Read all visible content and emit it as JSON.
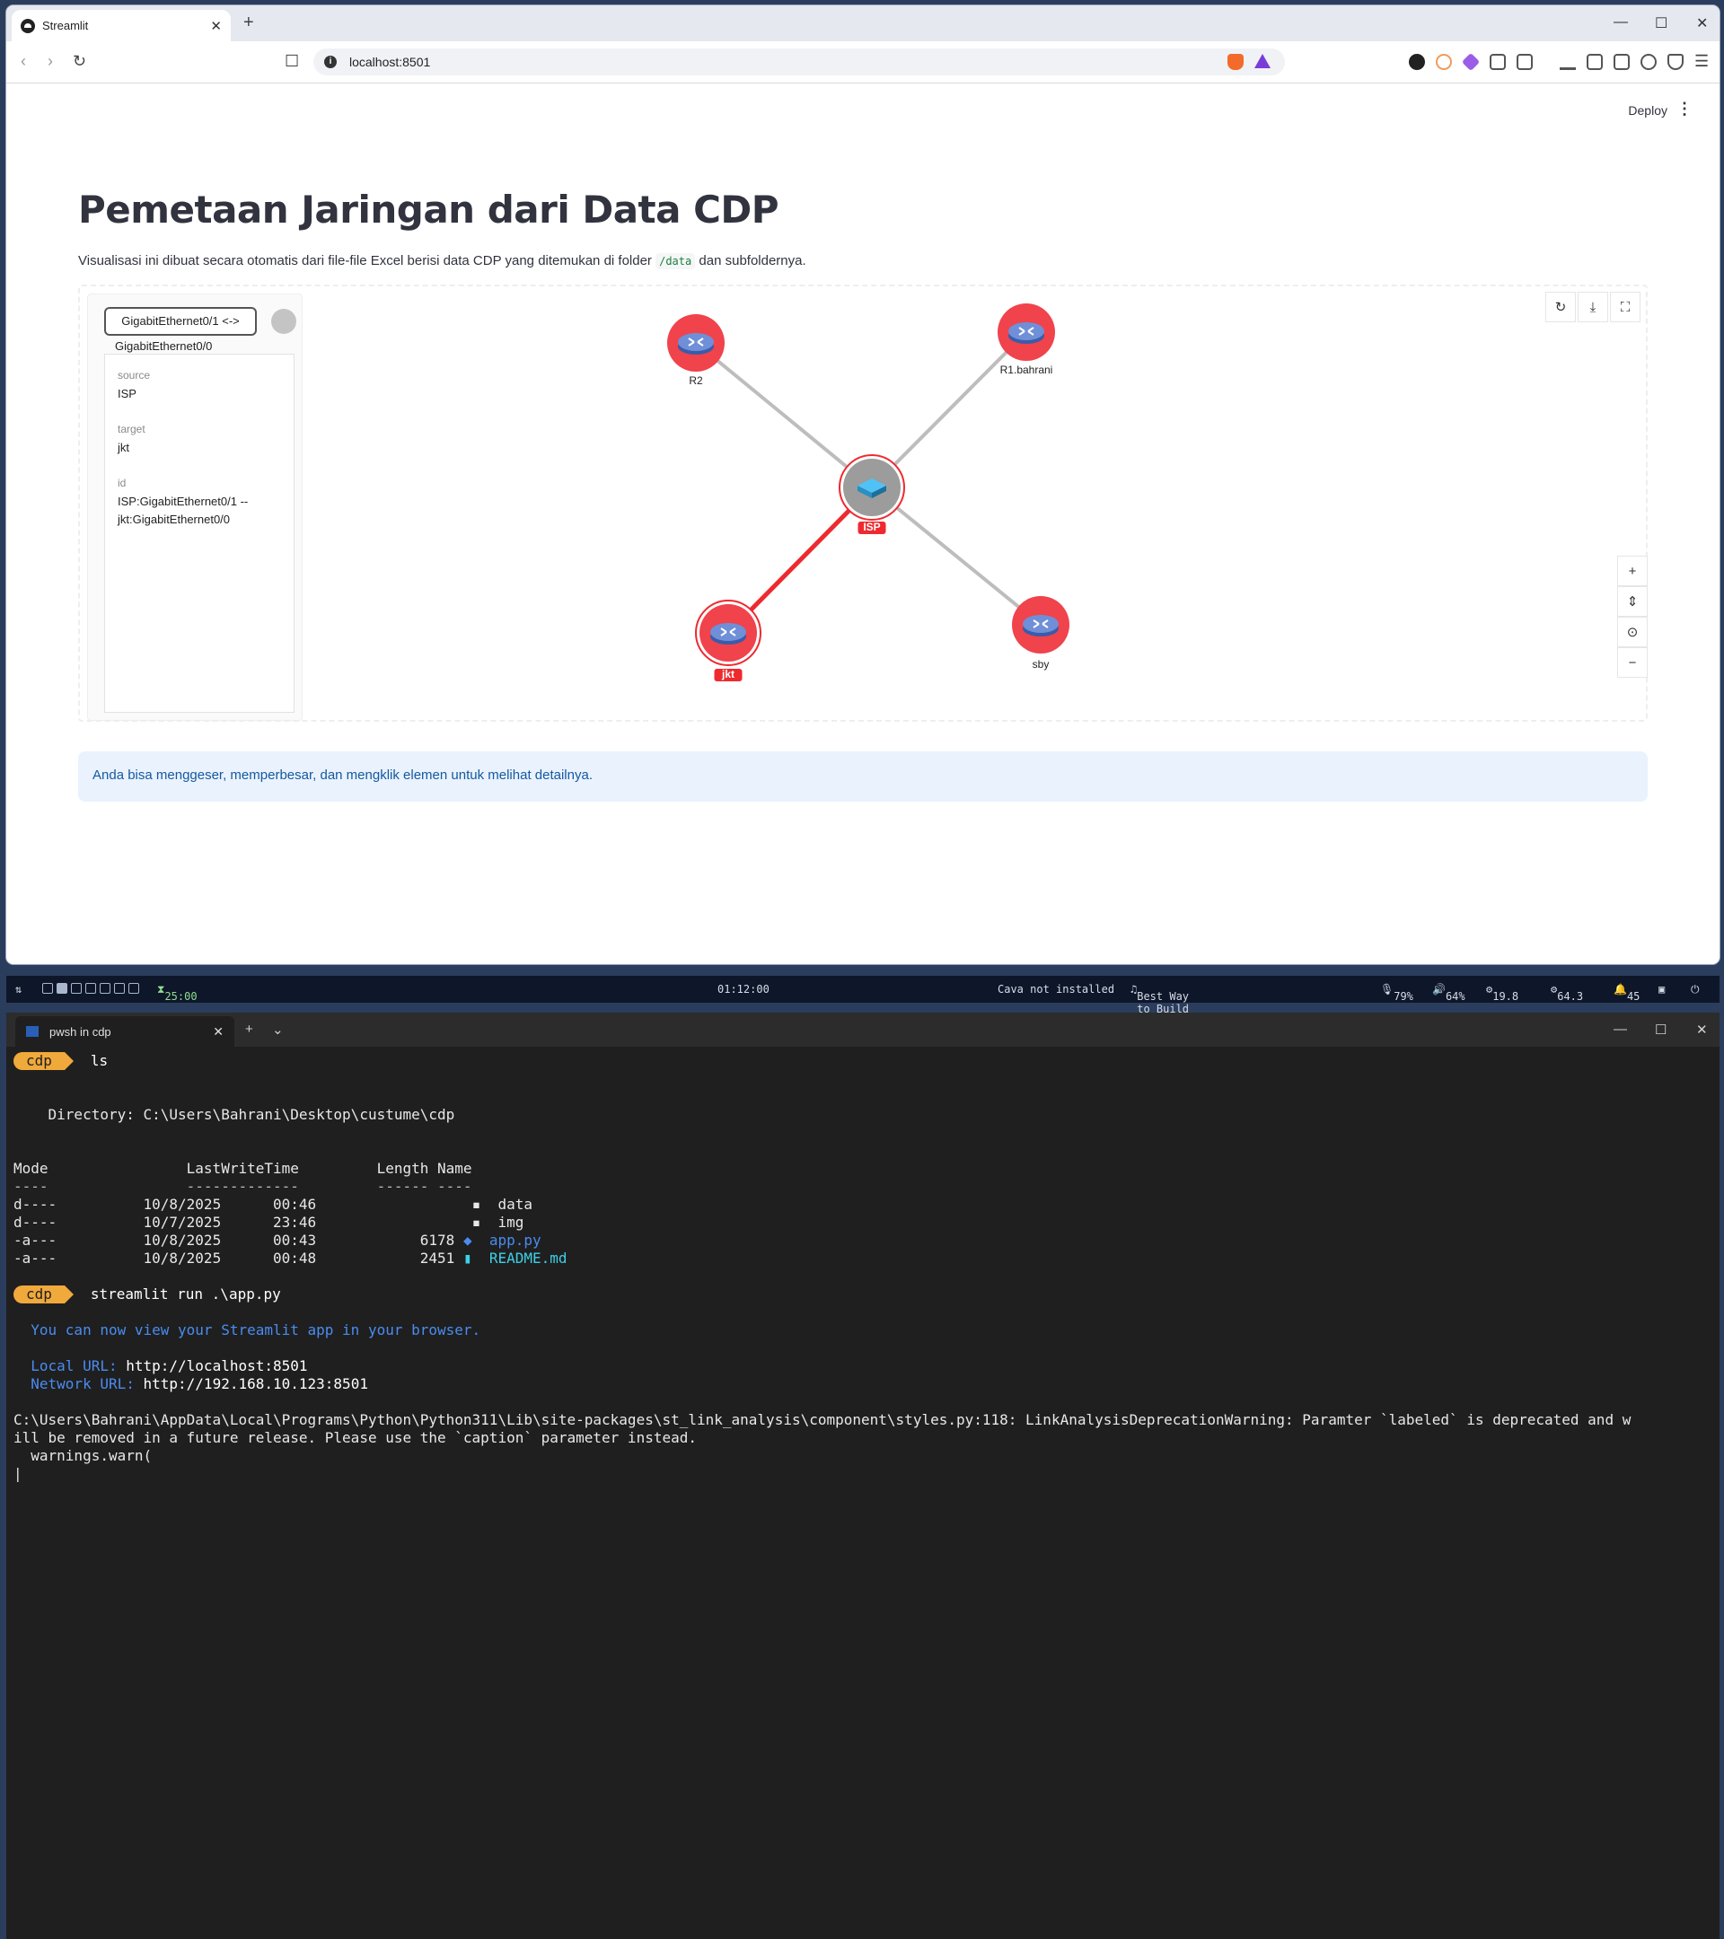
{
  "browser": {
    "tab_title": "Streamlit",
    "url": "localhost:8501"
  },
  "app": {
    "deploy_label": "Deploy",
    "title": "Pemetaan Jaringan dari Data CDP",
    "description_before": "Visualisasi ini dibuat secara otomatis dari file-file Excel berisi data CDP yang ditemukan di folder",
    "description_code": "/data",
    "description_after": "dan subfoldernya.",
    "info_text": "Anda bisa menggeser, memperbesar, dan mengklik elemen untuk melihat detailnya."
  },
  "selection": {
    "edge_label_line1": "GigabitEthernet0/1 <->",
    "edge_label_line2": "GigabitEthernet0/0",
    "props": [
      {
        "key": "source",
        "value": "ISP"
      },
      {
        "key": "target",
        "value": "jkt"
      },
      {
        "key": "id",
        "value": "ISP:GigabitEthernet0/1 --\njkt:GigabitEthernet0/0"
      }
    ]
  },
  "graph": {
    "nodes": [
      {
        "id": "R2",
        "label": "R2",
        "type": "router",
        "selected": false,
        "badge": false
      },
      {
        "id": "R1.bahrani",
        "label": "R1.bahrani",
        "type": "router",
        "selected": false,
        "badge": false
      },
      {
        "id": "ISP",
        "label": "ISP",
        "type": "switch",
        "selected": true,
        "badge": true
      },
      {
        "id": "jkt",
        "label": "jkt",
        "type": "router",
        "selected": true,
        "badge": true
      },
      {
        "id": "sby",
        "label": "sby",
        "type": "router",
        "selected": false,
        "badge": false
      }
    ],
    "edges": [
      {
        "source": "ISP",
        "target": "R2",
        "highlight": false
      },
      {
        "source": "ISP",
        "target": "R1.bahrani",
        "highlight": false
      },
      {
        "source": "ISP",
        "target": "jkt",
        "highlight": true
      },
      {
        "source": "ISP",
        "target": "sby",
        "highlight": false
      }
    ],
    "colors": {
      "router": "#f0434c",
      "switch": "#9c9c9c",
      "edge": "#bdbdbd",
      "highlight": "#ee2a2f"
    }
  },
  "statusbar": {
    "timer": "25:00",
    "clock": "01:12:00",
    "cava": "Cava not installed",
    "music": "Best Way to Build Network Analys...",
    "mic": "79%",
    "volume": "64%",
    "cpu": "19.8",
    "gpu": "64.3",
    "notif": "45"
  },
  "terminal": {
    "tab_title": "pwsh in cdp",
    "prompt_dir": "cdp",
    "cmd1": "ls",
    "directory_line": "    Directory: C:\\Users\\Bahrani\\Desktop\\custume\\cdp",
    "col_mode": "Mode",
    "col_lwt": "LastWriteTime",
    "col_length": "Length",
    "col_name": "Name",
    "files": [
      {
        "mode": "d----",
        "date": "10/8/2025",
        "time": "00:46",
        "length": "",
        "name": "data"
      },
      {
        "mode": "d----",
        "date": "10/7/2025",
        "time": "23:46",
        "length": "",
        "name": "img"
      },
      {
        "mode": "-a---",
        "date": "10/8/2025",
        "time": "00:43",
        "length": "6178",
        "name": "app.py"
      },
      {
        "mode": "-a---",
        "date": "10/8/2025",
        "time": "00:48",
        "length": "2451",
        "name": "README.md"
      }
    ],
    "cmd2": "streamlit run .\\app.py",
    "view_msg": "  You can now view your Streamlit app in your browser.",
    "local_label": "  Local URL: ",
    "local_url": "http://localhost:8501",
    "network_label": "  Network URL: ",
    "network_url": "http://192.168.10.123:8501",
    "warn_line1": "C:\\Users\\Bahrani\\AppData\\Local\\Programs\\Python\\Python311\\Lib\\site-packages\\st_link_analysis\\component\\styles.py:118: LinkAnalysisDeprecationWarning: Paramter `labeled` is deprecated and w",
    "warn_line2": "ill be removed in a future release. Please use the `caption` parameter instead.",
    "warn_line3": "  warnings.warn("
  }
}
